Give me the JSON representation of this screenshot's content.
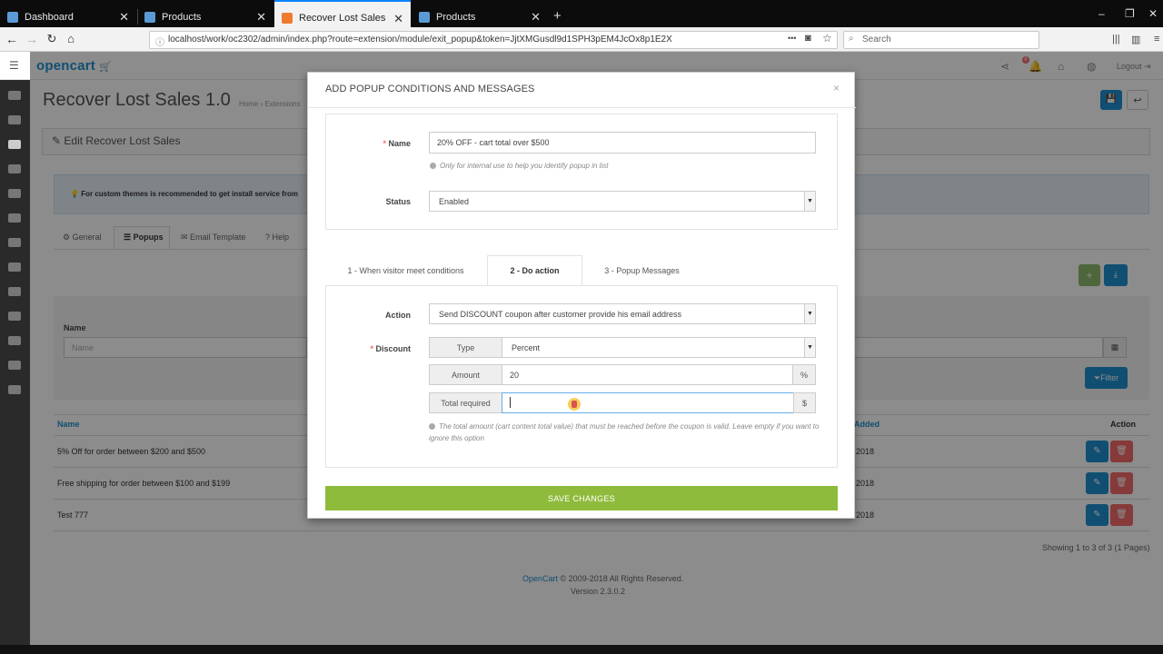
{
  "browser": {
    "tabs": [
      {
        "label": "Dashboard",
        "active": false
      },
      {
        "label": "Products",
        "active": false
      },
      {
        "label": "Recover Lost Sales",
        "active": true
      },
      {
        "label": "Products",
        "active": false
      }
    ],
    "new_tab": "+",
    "url": "localhost/work/oc2302/admin/index.php?route=extension/module/exit_popup&token=JjtXMGusdl9d1SPH3pEM4JcOx8p1E2X",
    "search_placeholder": "Search",
    "menu_dots": "•••"
  },
  "header": {
    "logo": "opencart",
    "notification_count": "8",
    "logout": "Logout"
  },
  "page": {
    "title": "Recover Lost Sales 1.0",
    "breadcrumb": [
      "Home",
      "Extensions"
    ],
    "panel_title": "Edit Recover Lost Sales",
    "alert": "For custom themes is recommended to get install service from",
    "tabs": [
      "General",
      "Popups",
      "Email Template",
      "Help"
    ],
    "filter": {
      "name_label": "Name",
      "name_placeholder": "Name",
      "button": "Filter"
    },
    "table": {
      "headers": [
        "Name",
        "Added",
        "Action"
      ],
      "rows": [
        {
          "name": "5% Off for order between $200 and $500",
          "date": "2018"
        },
        {
          "name": "Free shipping for order between $100 and $199",
          "date": "2018"
        },
        {
          "name": "Test 777",
          "date": "2018"
        }
      ],
      "pagination": "Showing 1 to 3 of 3 (1 Pages)"
    },
    "footer": {
      "link": "OpenCart",
      "copyright": "© 2009-2018 All Rights Reserved.",
      "version": "Version 2.3.0.2"
    }
  },
  "modal": {
    "title": "ADD POPUP CONDITIONS AND MESSAGES",
    "close": "×",
    "name_label": "Name",
    "name_value": "20% OFF - cart total over $500",
    "name_help": "Only for internal use to help you identify popup in list",
    "status_label": "Status",
    "status_value": "Enabled",
    "tabs": [
      {
        "label": "1 - When visitor meet conditions",
        "active": false
      },
      {
        "label": "2 - Do action",
        "active": true
      },
      {
        "label": "3 - Popup Messages",
        "active": false
      }
    ],
    "action_label": "Action",
    "action_value": "Send DISCOUNT coupon after customer provide his email address",
    "discount_label": "Discount",
    "type_label": "Type",
    "type_value": "Percent",
    "amount_label": "Amount",
    "amount_value": "20",
    "amount_unit": "%",
    "total_label": "Total required",
    "total_value": "",
    "total_unit": "$",
    "total_help": "The total amount (cart content total value) that must be reached before the coupon is valid. Leave empty if you want to ignore this option",
    "save": "SAVE CHANGES"
  },
  "colors": {
    "accent": "#1e91cf",
    "save": "#8fbb3c",
    "danger": "#f56b6b"
  }
}
